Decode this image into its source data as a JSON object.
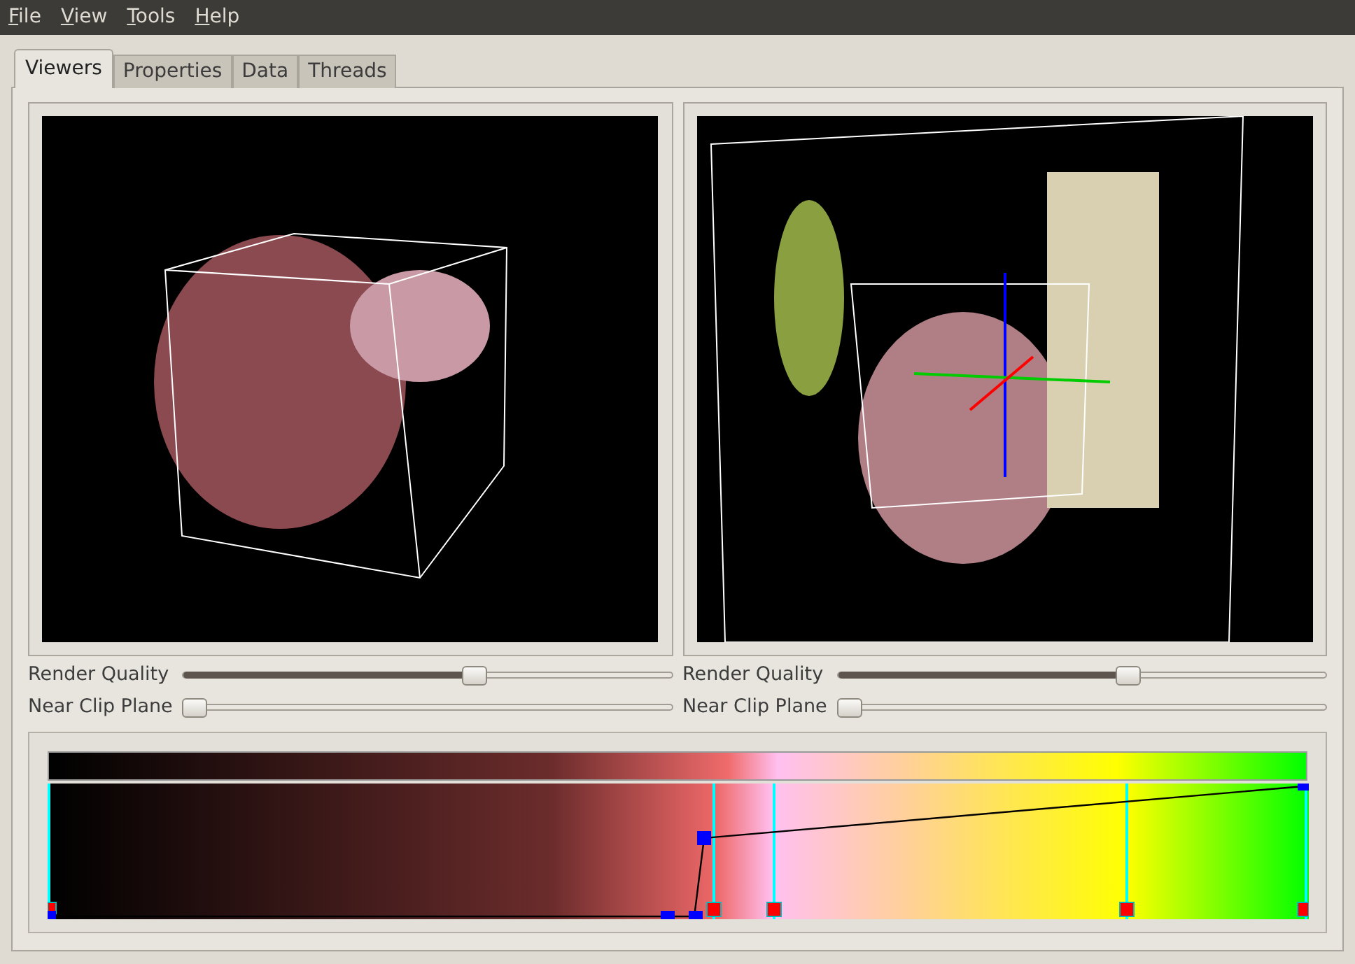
{
  "menu": [
    "File",
    "View",
    "Tools",
    "Help"
  ],
  "tabs": [
    {
      "label": "Viewers",
      "selected": true
    },
    {
      "label": "Properties",
      "selected": false
    },
    {
      "label": "Data",
      "selected": false
    },
    {
      "label": "Threads",
      "selected": false
    }
  ],
  "viewers": [
    {
      "sliders": [
        {
          "label": "Render Quality",
          "level": 0.6
        },
        {
          "label": "Near Clip Plane",
          "level": 0.0
        }
      ]
    },
    {
      "sliders": [
        {
          "label": "Render Quality",
          "level": 0.6
        },
        {
          "label": "Near Clip Plane",
          "level": 0.0
        }
      ]
    }
  ]
}
